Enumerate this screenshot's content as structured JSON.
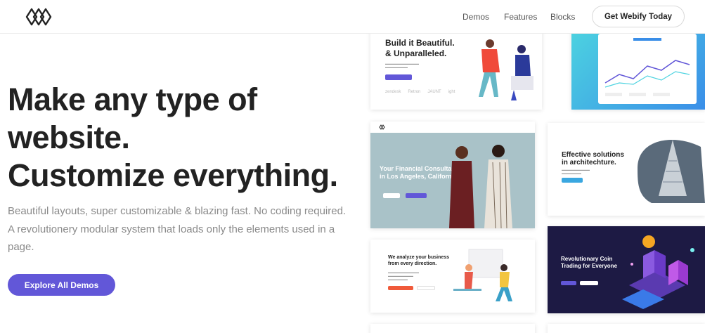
{
  "header": {
    "logo": "webify-logo",
    "nav": [
      "Demos",
      "Features",
      "Blocks"
    ],
    "cta": "Get Webify Today"
  },
  "hero": {
    "title_lines": [
      "Make any type of",
      "website.",
      "Customize everything."
    ],
    "description": "Beautiful layouts, super customizable & blazing fast. No coding required. A revolutionery modular system that loads only the elements used in a page.",
    "button": "Explore All Demos"
  },
  "cards": {
    "c1": {
      "title_lines": [
        "Build it Beautiful.",
        "& Unparalleled."
      ],
      "logos": [
        "zendesk",
        "Retron",
        "JAUNT",
        "ight"
      ]
    },
    "c3": {
      "title_lines": [
        "Your Financial Consultant",
        "in Los Angeles, California"
      ]
    },
    "c4": {
      "title_lines": [
        "Effective solutions",
        "in architechture."
      ]
    },
    "c5": {
      "title_lines": [
        "We analyze your business",
        "from every direction."
      ]
    },
    "c6": {
      "title_lines": [
        "Revolutionary Coin",
        "Trading for Everyone"
      ]
    }
  },
  "colors": {
    "accent": "#6257d8",
    "text": "#222222",
    "muted": "#8a8a8a"
  }
}
